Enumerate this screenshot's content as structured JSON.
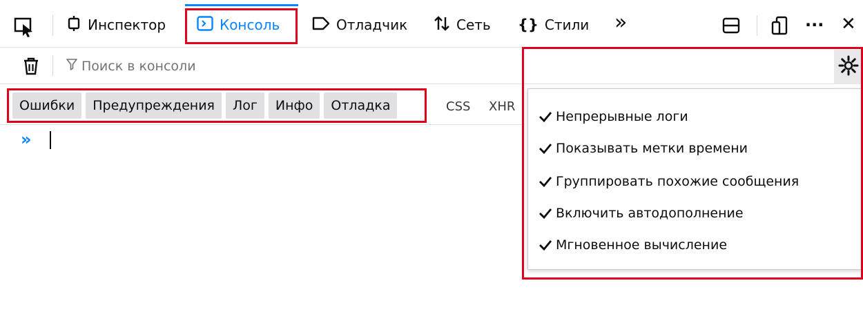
{
  "toolbar": {
    "tabs": [
      {
        "label": "Инспектор",
        "icon": "inspector-icon"
      },
      {
        "label": "Консоль",
        "icon": "console-icon"
      },
      {
        "label": "Отладчик",
        "icon": "debugger-icon"
      },
      {
        "label": "Сеть",
        "icon": "network-icon"
      },
      {
        "label": "Стили",
        "icon": "style-editor-icon"
      }
    ],
    "more_glyph": "»",
    "overflow_glyph": "···",
    "close_glyph": "✕",
    "active_tab": "Консоль",
    "accent_color": "#0a84ff"
  },
  "filter": {
    "search_placeholder": "Поиск в консоли"
  },
  "levels": [
    "Ошибки",
    "Предупреждения",
    "Лог",
    "Инфо",
    "Отладка"
  ],
  "extra_filters": [
    "CSS",
    "XHR"
  ],
  "console": {
    "prompt_glyph": "»"
  },
  "settings_menu": {
    "items": [
      "Непрерывные логи",
      "Показывать метки времени",
      "Группировать похожие сообщения",
      "Включить автодополнение",
      "Мгновенное вычисление"
    ]
  },
  "highlight_color": "#e0001b"
}
